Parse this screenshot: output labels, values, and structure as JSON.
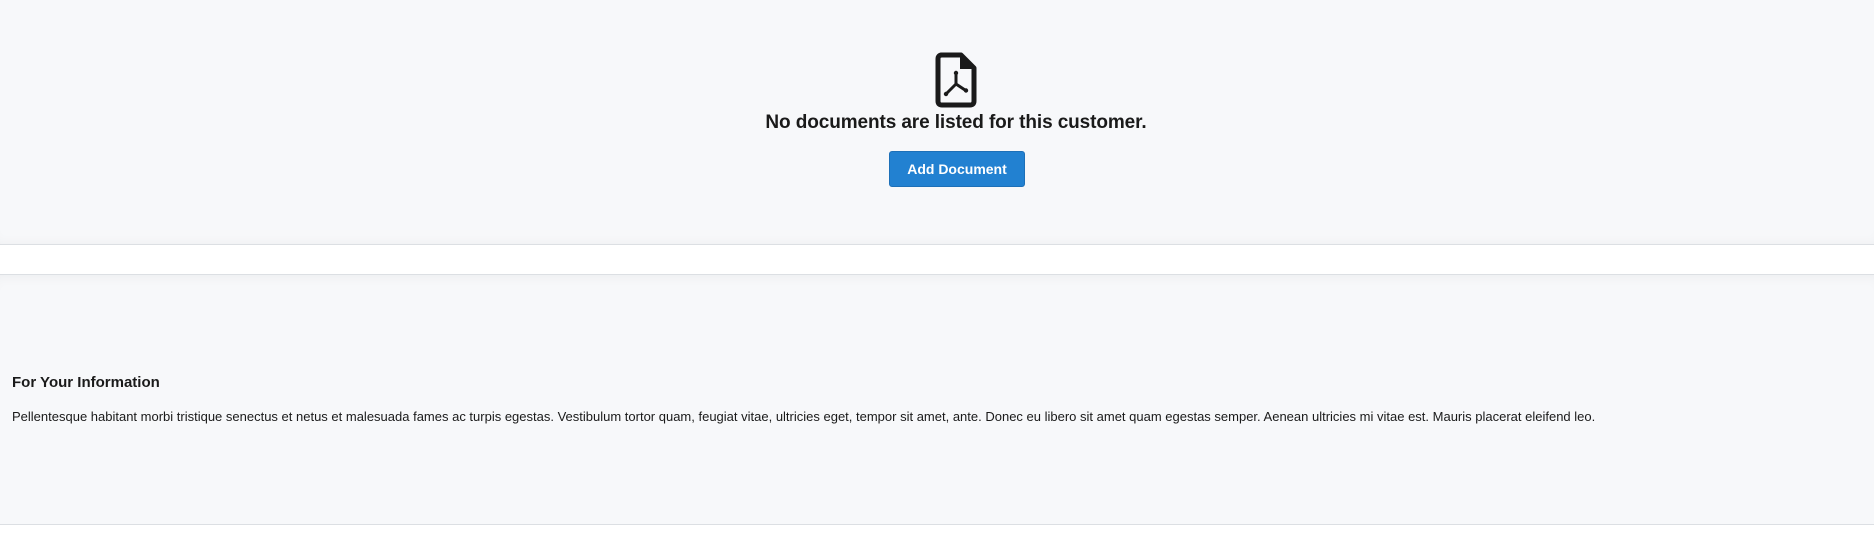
{
  "empty_state": {
    "icon": "pdf-file-icon",
    "message": "No documents are listed for this customer.",
    "add_button_label": "Add Document"
  },
  "info": {
    "title": "For Your Information",
    "body": "Pellentesque habitant morbi tristique senectus et netus et malesuada fames ac turpis egestas. Vestibulum tortor quam, feugiat vitae, ultricies eget, tempor sit amet, ante. Donec eu libero sit amet quam egestas semper. Aenean ultricies mi vitae est. Mauris placerat eleifend leo."
  },
  "colors": {
    "panel_background": "#f7f8fa",
    "accent": "#2281d1",
    "text": "#1a1a1a"
  }
}
